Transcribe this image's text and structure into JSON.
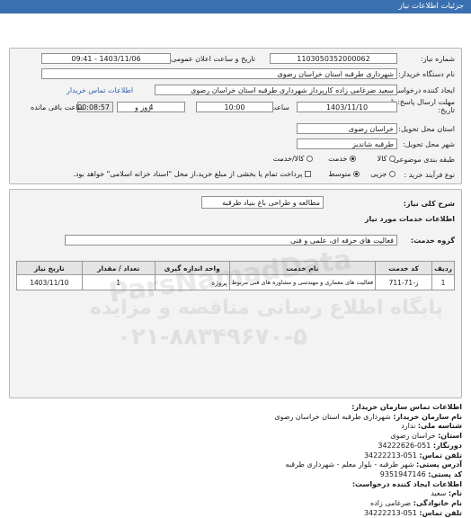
{
  "header": {
    "title": "جزئیات اطلاعات نیاز"
  },
  "form": {
    "need_number_label": "شماره نیاز:",
    "need_number": "1103050352000062",
    "announce_label": "تاریخ و ساعت اعلان عمومی:",
    "announce_value": "1403/11/06 - 09:41",
    "buyer_org_label": "نام دستگاه خریدار:",
    "buyer_org": "شهرداری طرقبه استان خراسان رضوی",
    "creator_label": "ایجاد کننده درخواست:",
    "creator": "سعید ضرغامی زاده کارپرداز  شهرداری طرقبه استان خراسان رضوی",
    "contact_link": "اطلاعات تماس خریدار",
    "deadline_label_1": "مهلت ارسال پاسخ: تا",
    "deadline_label_2": "تاریخ:",
    "deadline_date": "1403/11/10",
    "time_label": "ساعت",
    "deadline_time": "10:00",
    "days_value": "4",
    "days_label": "روز و",
    "remaining_value": "00:08:57",
    "remaining_label": "ساعت باقی مانده",
    "province_label": "استان محل تحویل:",
    "province": "خراسان رضوی",
    "city_label": "شهر محل تحویل:",
    "city": "طرقبه شاندیز",
    "category_label": "طبقه بندی موضوعی:",
    "category_options": [
      "کالا",
      "خدمت",
      "کالا/خدمت"
    ],
    "category_selected": "خدمت",
    "process_label": "نوع فرآیند خرید :",
    "process_options": [
      "جزیی",
      "متوسط"
    ],
    "process_selected": "متوسط",
    "payment_note": "پرداخت تمام یا بخشی از مبلغ خرید،از محل \"اسناد خزانه اسلامی\" خواهد بود."
  },
  "summary": {
    "label": "شرح کلی نیاز:",
    "value": "مطالعه و طراحی باغ بنیاد طرقبه"
  },
  "services": {
    "heading": "اطلاعات خدمات مورد نیاز",
    "group_label": "گروه خدمت:",
    "group_value": "فعالیت های حرفه ای، علمی و فنی",
    "columns": [
      "ردیف",
      "کد خدمت",
      "نام خدمت",
      "واحد اندازه گیری",
      "تعداد / مقدار",
      "تاریخ نیاز"
    ],
    "rows": [
      [
        "1",
        "ز-71-711",
        "فعالیت های معماری و مهندسی و مشاوره های فنی مربوط",
        "پروژه",
        "1",
        "1403/11/10"
      ]
    ]
  },
  "buyer_contact": {
    "heading": "اطلاعات تماس سازمان خریدار:",
    "lines": [
      {
        "label": "نام سازمان خریدار:",
        "value": " شهرداری طرقبه استان خراسان رضوی"
      },
      {
        "label": "شناسه ملی:",
        "value": " ندارد"
      },
      {
        "label": "استان:",
        "value": " خراسان رضوی"
      },
      {
        "label": "دورنگار:",
        "value": " 051-34222626"
      },
      {
        "label": "تلفن تماس:",
        "value": " 051-34222213"
      },
      {
        "label": "آدرس پستی:",
        "value": " شهر طرقبه - بلوار معلم - شهرداری طرقبه"
      },
      {
        "label": "کد پستی:",
        "value": " 9351947146"
      }
    ]
  },
  "creator_contact": {
    "heading": "اطلاعات ایجاد کننده درخواست:",
    "lines": [
      {
        "label": "نام:",
        "value": " سعید"
      },
      {
        "label": "نام خانوادگی:",
        "value": " ضرغامی زاده"
      },
      {
        "label": "تلفن تماس:",
        "value": " 051-34222213"
      }
    ]
  },
  "watermark": {
    "brand": "ParsNamadData",
    "line1": "پایگاه اطلاع رسانی مناقصه و مزایده",
    "phone": "۰۲۱-۸۸۳۴۹۶۷۰-۵"
  }
}
